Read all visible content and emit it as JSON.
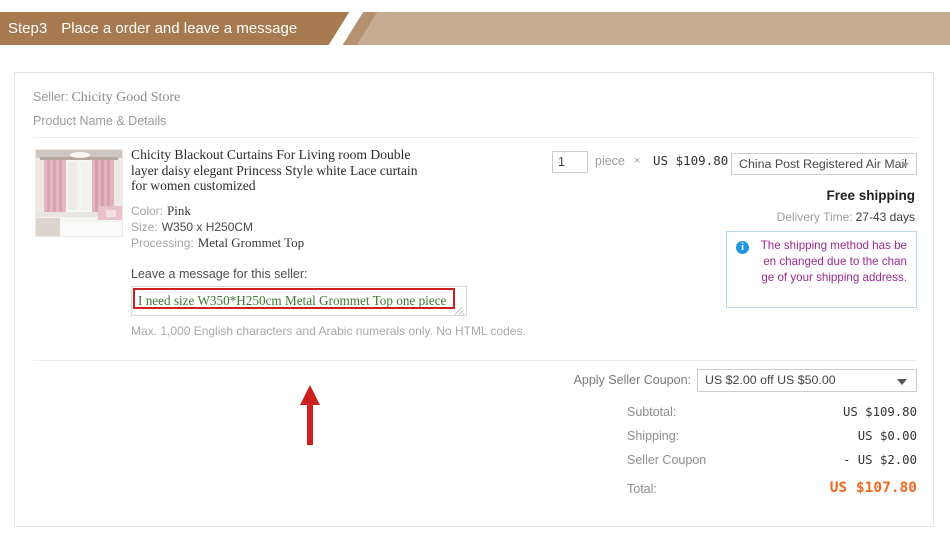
{
  "banner": {
    "step": "Step3",
    "title": "Place a order and leave a message",
    "band_color": "#a6794f",
    "fade_color": "#c6ac92"
  },
  "seller": {
    "label": "Seller:",
    "name": "Chicity Good Store",
    "product_header": "Product Name & Details"
  },
  "product": {
    "thumb_alt": "pink-curtains-bedroom-photo",
    "title": "Chicity Blackout Curtains For Living room Double layer daisy elegant Princess Style white Lace curtain for women customized",
    "attributes": [
      {
        "label": "Color:",
        "value": "Pink"
      },
      {
        "label": "Size:",
        "value": "W350 x H250CM"
      },
      {
        "label": "Processing:",
        "value": "Metal Grommet Top"
      }
    ],
    "quantity": "1",
    "unit": "piece",
    "times": "×",
    "unit_price": "US $109.80"
  },
  "message": {
    "label": "Leave a message for this seller:",
    "value": "I need size W350*H250cm Metal Grommet Top one piece",
    "placeholder": "",
    "hint": "Max. 1,000 English characters and Arabic numerals only. No HTML codes.",
    "text_color": "#3e7a32"
  },
  "shipping": {
    "method": "China Post Registered Air Mail",
    "free_label": "Free shipping",
    "delivery_label": "Delivery Time:",
    "delivery_value": "27-43 days",
    "notice_icon": "info-circle-icon",
    "notice_text": "The shipping method has been changed due to the change of your shipping address.",
    "notice_color": "#9c2a8c",
    "notice_border": "#b9d9ef"
  },
  "coupon": {
    "label": "Apply Seller Coupon:",
    "selected": "US $2.00 off US $50.00"
  },
  "totals": {
    "rows": [
      {
        "label": "Subtotal:",
        "value": "US $109.80"
      },
      {
        "label": "Shipping:",
        "value": "US $0.00"
      },
      {
        "label": "Seller Coupon",
        "value": "- US $2.00"
      }
    ],
    "grand_label": "Total:",
    "grand_value": "US $107.80",
    "grand_color": "#f26a21"
  },
  "annotations": {
    "highlight_box": "red-rectangle-around-message-text",
    "arrow": "red-up-arrow-pointing-to-message-box",
    "color": "#cf2020"
  }
}
